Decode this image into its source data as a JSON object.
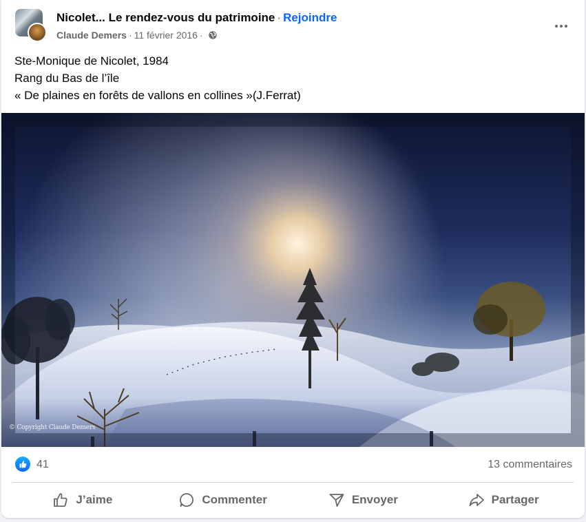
{
  "post": {
    "group_name": "Nicolet... Le rendez-vous du patrimoine",
    "separator": "·",
    "join_label": "Rejoindre",
    "author": "Claude Demers",
    "date": "11 février 2016",
    "visibility_icon": "globe-icon",
    "text_lines": [
      "Ste-Monique de Nicolet, 1984",
      "Rang du Bas de l’île",
      "« De plaines en forêts de vallons en collines »(J.Ferrat)"
    ],
    "photo_watermark": "© Copyright Claude Demers"
  },
  "stats": {
    "reaction_icon": "like-icon",
    "like_count": "41",
    "comments": "13 commentaires"
  },
  "actions": {
    "like": "J’aime",
    "comment": "Commenter",
    "send": "Envoyer",
    "share": "Partager"
  },
  "colors": {
    "accent": "#0866ff",
    "secondary_text": "#65676b",
    "background": "#f0f2f5"
  }
}
